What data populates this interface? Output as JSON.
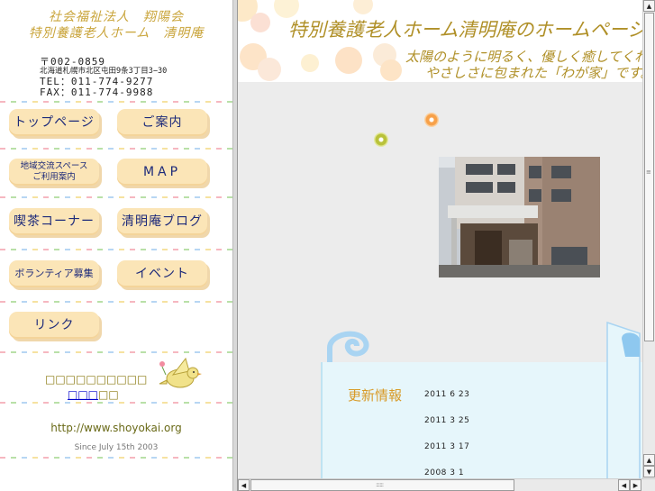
{
  "sidebar": {
    "org_line1": "社会福祉法人　翔陽会",
    "org_line2": "特別養護老人ホーム　清明庵",
    "address": {
      "postal": "〒002-0859",
      "street": "北海道札幌市北区屯田9条3丁目3−30",
      "tel": "TEL：011-774-9277",
      "fax": "FAX：011-774-9988"
    },
    "nav": [
      {
        "label": "トップページ"
      },
      {
        "label": "ご案内"
      },
      {
        "label_line1": "地域交流スペース",
        "label_line2": "ご利用案内"
      },
      {
        "label": "MAP"
      },
      {
        "label": "喫茶コーナー"
      },
      {
        "label": "清明庵ブログ"
      },
      {
        "label": "ボランティア募集"
      },
      {
        "label": "イベント"
      },
      {
        "label": "リンク"
      }
    ],
    "bird_text": "□□□□□□□□□□",
    "bird_link": "□□□",
    "bird_link_suffix": "□□",
    "url": "http://www.shoyokai.org",
    "since": "Since July 15th 2003"
  },
  "main": {
    "banner_title": "特別養護老人ホーム清明庵のホームページ",
    "banner_sub1": "太陽のように明るく、優しく癒してくれる",
    "banner_sub2": "やさしさに包まれた「わが家」です。",
    "updates_title": "更新情報",
    "updates": [
      "2011 6 23",
      "2011 3 25",
      "2011 3 17",
      "2008 3 1"
    ]
  },
  "scroll": {
    "up": "▲",
    "down": "▼",
    "left": "◀",
    "right": "▶",
    "grip": "::::::"
  },
  "colors": {
    "accent_gold": "#b09028",
    "button_bg": "#fbe5b7",
    "button_text": "#1d2a7a",
    "update_panel": "#e6f6fb"
  }
}
